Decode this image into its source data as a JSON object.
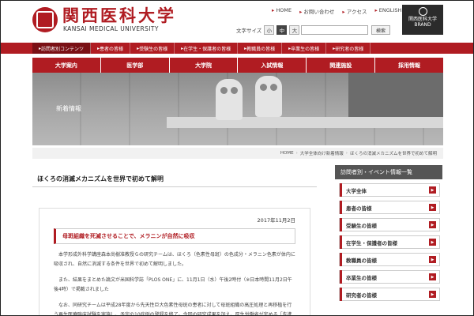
{
  "header": {
    "logo_jp": "関西医科大学",
    "logo_en": "KANSAI MEDICAL UNIVERSITY",
    "utility_links": [
      "HOME",
      "お問い合わせ",
      "アクセス",
      "ENGLISH"
    ],
    "font_size_label": "文字サイズ",
    "font_sizes": [
      "小",
      "中",
      "大"
    ],
    "search_placeholder": "",
    "search_button": "検索",
    "brand_line1": "関西医科大学",
    "brand_line2": "BRAND"
  },
  "audience_nav": [
    "訪問者別コンテンツ",
    "患者の皆様",
    "受験生の皆様",
    "在学生・保護者の皆様",
    "教職員の皆様",
    "卒業生の皆様",
    "研究者の皆様"
  ],
  "main_nav": [
    "大学案内",
    "医学部",
    "大学院",
    "入試情報",
    "関連施設",
    "採用情報"
  ],
  "hero": {
    "title": "新着情報"
  },
  "breadcrumb": [
    "HOME",
    "大学全体向け新着情報",
    "ほくろの消滅メカニズムを世界で初めて解明"
  ],
  "article": {
    "title": "ほくろの消滅メカニズムを世界で初めて解明",
    "date": "2017年11月2日",
    "subtitle": "母斑組織を死滅させることで、メラニンが自然に吸収",
    "paragraphs": [
      "本学形成外科学講座森本尚樹准教授らの研究チームは、ほくろ（色素性母斑）の色成分・メラニン色素が体内に吸収され、自然に消滅する条件を世界で初めて解明しました。",
      "また、結果をまとめた論文が米国科学誌「PLOS ONE」に、11月1日（水）午後2時付（※日本時間11月2日午後4時）で掲載されました",
      "なお、同研究チームは平成28年度から先天性巨大色素性母斑の患者に対して母斑組織の高圧処理と再移植を行う再生医療臨床試験を実施し、予定の10症例の登録を終了。今回の研究成果を加え、厚生労働省が定める「先進医療B」の承認に必要な5例程度の新たな臨床研究を準備しています。"
    ]
  },
  "sidebar": {
    "heading": "訪問者別・イベント情報一覧",
    "items": [
      "大学全体",
      "患者の皆様",
      "受験生の皆様",
      "在学生・保護者の皆様",
      "教職員の皆様",
      "卒業生の皆様",
      "研究者の皆様"
    ]
  },
  "colors": {
    "accent": "#b01c22",
    "dark": "#555555"
  }
}
